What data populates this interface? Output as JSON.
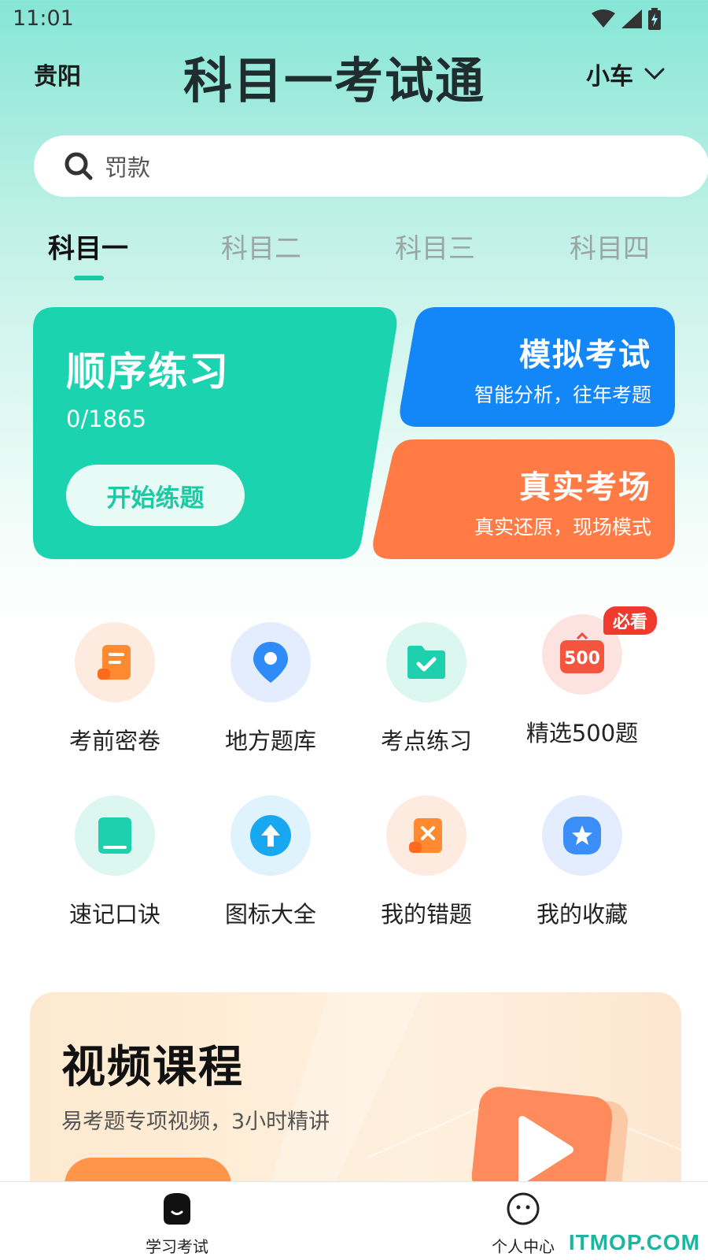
{
  "status_bar": {
    "time": "11:01"
  },
  "header": {
    "city": "贵阳",
    "title": "科目一考试通",
    "vehicle": "小车"
  },
  "search": {
    "placeholder": "罚款"
  },
  "tabs": [
    {
      "label": "科目一",
      "active": true
    },
    {
      "label": "科目二",
      "active": false
    },
    {
      "label": "科目三",
      "active": false
    },
    {
      "label": "科目四",
      "active": false
    }
  ],
  "cards": {
    "sequential": {
      "title": "顺序练习",
      "progress": "0/1865",
      "button": "开始练题",
      "color": "#1cd3b0"
    },
    "mock_exam": {
      "title": "模拟考试",
      "subtitle": "智能分析，往年考题",
      "color": "#1487f8"
    },
    "real_exam": {
      "title": "真实考场",
      "subtitle": "真实还原，现场模式",
      "color": "#ff7a45"
    }
  },
  "grid": [
    {
      "label": "考前密卷",
      "icon": "scroll-icon"
    },
    {
      "label": "地方题库",
      "icon": "location-pin-icon"
    },
    {
      "label": "考点练习",
      "icon": "folder-check-icon"
    },
    {
      "label": "精选500题",
      "icon": "500-icon",
      "badge": "必看",
      "icon_text": "500"
    },
    {
      "label": "速记口诀",
      "icon": "book-icon"
    },
    {
      "label": "图标大全",
      "icon": "arrow-up-icon"
    },
    {
      "label": "我的错题",
      "icon": "wrong-scroll-icon"
    },
    {
      "label": "我的收藏",
      "icon": "star-icon"
    }
  ],
  "video": {
    "title": "视频课程",
    "subtitle": "易考题专项视频，3小时精讲"
  },
  "bottom_nav": [
    {
      "label": "学习考试",
      "active": true
    },
    {
      "label": "个人中心",
      "active": false
    }
  ],
  "watermark": "ITMOP.COM"
}
